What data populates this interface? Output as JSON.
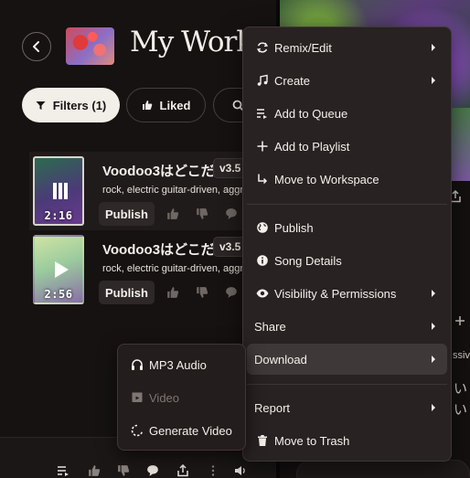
{
  "header": {
    "title": "My Works",
    "back_icon": "chevron-left-icon"
  },
  "filters": {
    "filter_label": "Filters (1)",
    "liked_label": "Liked"
  },
  "songs": [
    {
      "title": "Voodoo3はどこだ",
      "version": "v3.5",
      "tags": "rock, electric guitar-driven, aggressive",
      "duration": "2:16",
      "publish_label": "Publish",
      "state": "paused"
    },
    {
      "title": "Voodoo3はどこだ",
      "version": "v3.5",
      "tags": "rock, electric guitar-driven, aggressive",
      "duration": "2:56",
      "publish_label": "Publish",
      "state": "play"
    }
  ],
  "context_menu": {
    "items": [
      {
        "label": "Remix/Edit",
        "icon": "remix-icon",
        "submenu": true
      },
      {
        "label": "Create",
        "icon": "music-note-icon",
        "submenu": true
      },
      {
        "label": "Add to Queue",
        "icon": "add-to-queue-icon",
        "submenu": false
      },
      {
        "label": "Add to Playlist",
        "icon": "plus-icon",
        "submenu": false
      },
      {
        "label": "Move to Workspace",
        "icon": "move-arrow-icon",
        "submenu": false
      },
      {
        "label": "Publish",
        "icon": "globe-icon",
        "submenu": false
      },
      {
        "label": "Song Details",
        "icon": "info-icon",
        "submenu": false
      },
      {
        "label": "Visibility & Permissions",
        "icon": "eye-icon",
        "submenu": true
      },
      {
        "label": "Share",
        "icon": "",
        "submenu": true
      },
      {
        "label": "Download",
        "icon": "",
        "submenu": true,
        "highlighted": true
      },
      {
        "label": "Report",
        "icon": "",
        "submenu": true
      },
      {
        "label": "Move to Trash",
        "icon": "trash-icon",
        "submenu": false
      }
    ]
  },
  "download_submenu": {
    "items": [
      {
        "label": "MP3 Audio",
        "icon": "headphones-icon",
        "enabled": true
      },
      {
        "label": "Video",
        "icon": "video-icon",
        "enabled": false
      },
      {
        "label": "Generate Video",
        "icon": "spinner-icon",
        "enabled": true
      }
    ]
  },
  "right_panel": {
    "partial_text_1": "ssive",
    "partial_text_2": "い",
    "partial_text_3": "い"
  },
  "colors": {
    "background": "#161212",
    "menu_bg": "#282222",
    "highlight": "#3f3838",
    "text": "#f4f0ea",
    "filter_active_bg": "#f2eee8"
  }
}
